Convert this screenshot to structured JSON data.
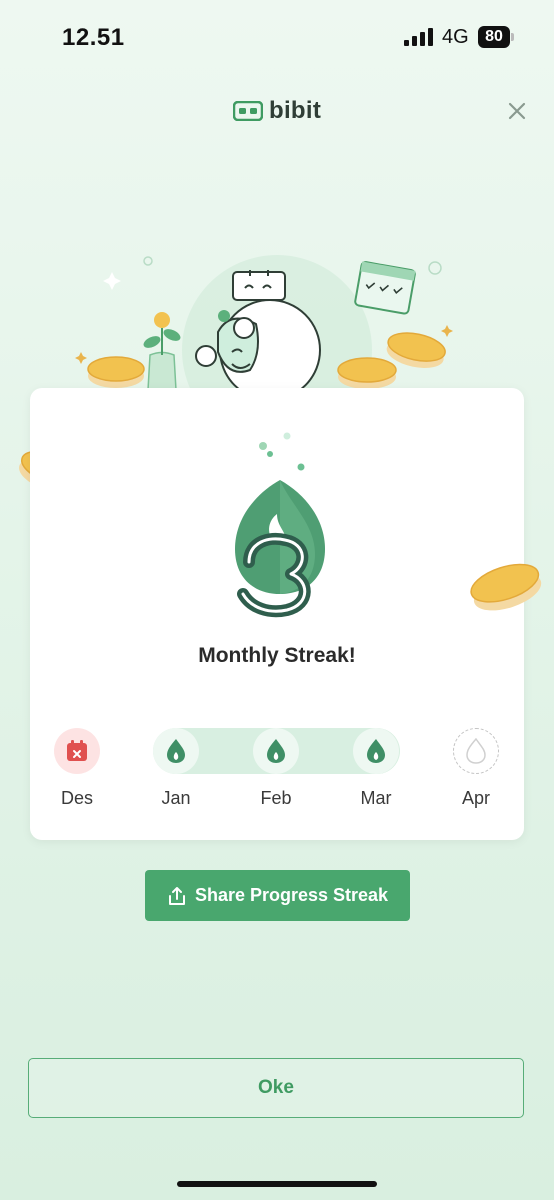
{
  "status_bar": {
    "time": "12.51",
    "network": "4G",
    "battery": "80"
  },
  "header": {
    "brand": "bibit"
  },
  "card": {
    "streak_number": 3,
    "title": "Monthly Streak!",
    "months": [
      {
        "label": "Des",
        "state": "missed",
        "icon": "calendar-missed-icon"
      },
      {
        "label": "Jan",
        "state": "streak",
        "icon": "flame-icon"
      },
      {
        "label": "Feb",
        "state": "streak",
        "icon": "flame-icon"
      },
      {
        "label": "Mar",
        "state": "streak",
        "icon": "flame-icon"
      },
      {
        "label": "Apr",
        "state": "upcoming",
        "icon": "flame-outline-icon"
      }
    ]
  },
  "share_button": {
    "label": "Share Progress Streak",
    "icon": "share-icon"
  },
  "ok_button": {
    "label": "Oke"
  },
  "colors": {
    "primary": "#49a76e",
    "flame_dark": "#3f8f66",
    "track": "#d8efe1",
    "missed": "#e0504f"
  }
}
